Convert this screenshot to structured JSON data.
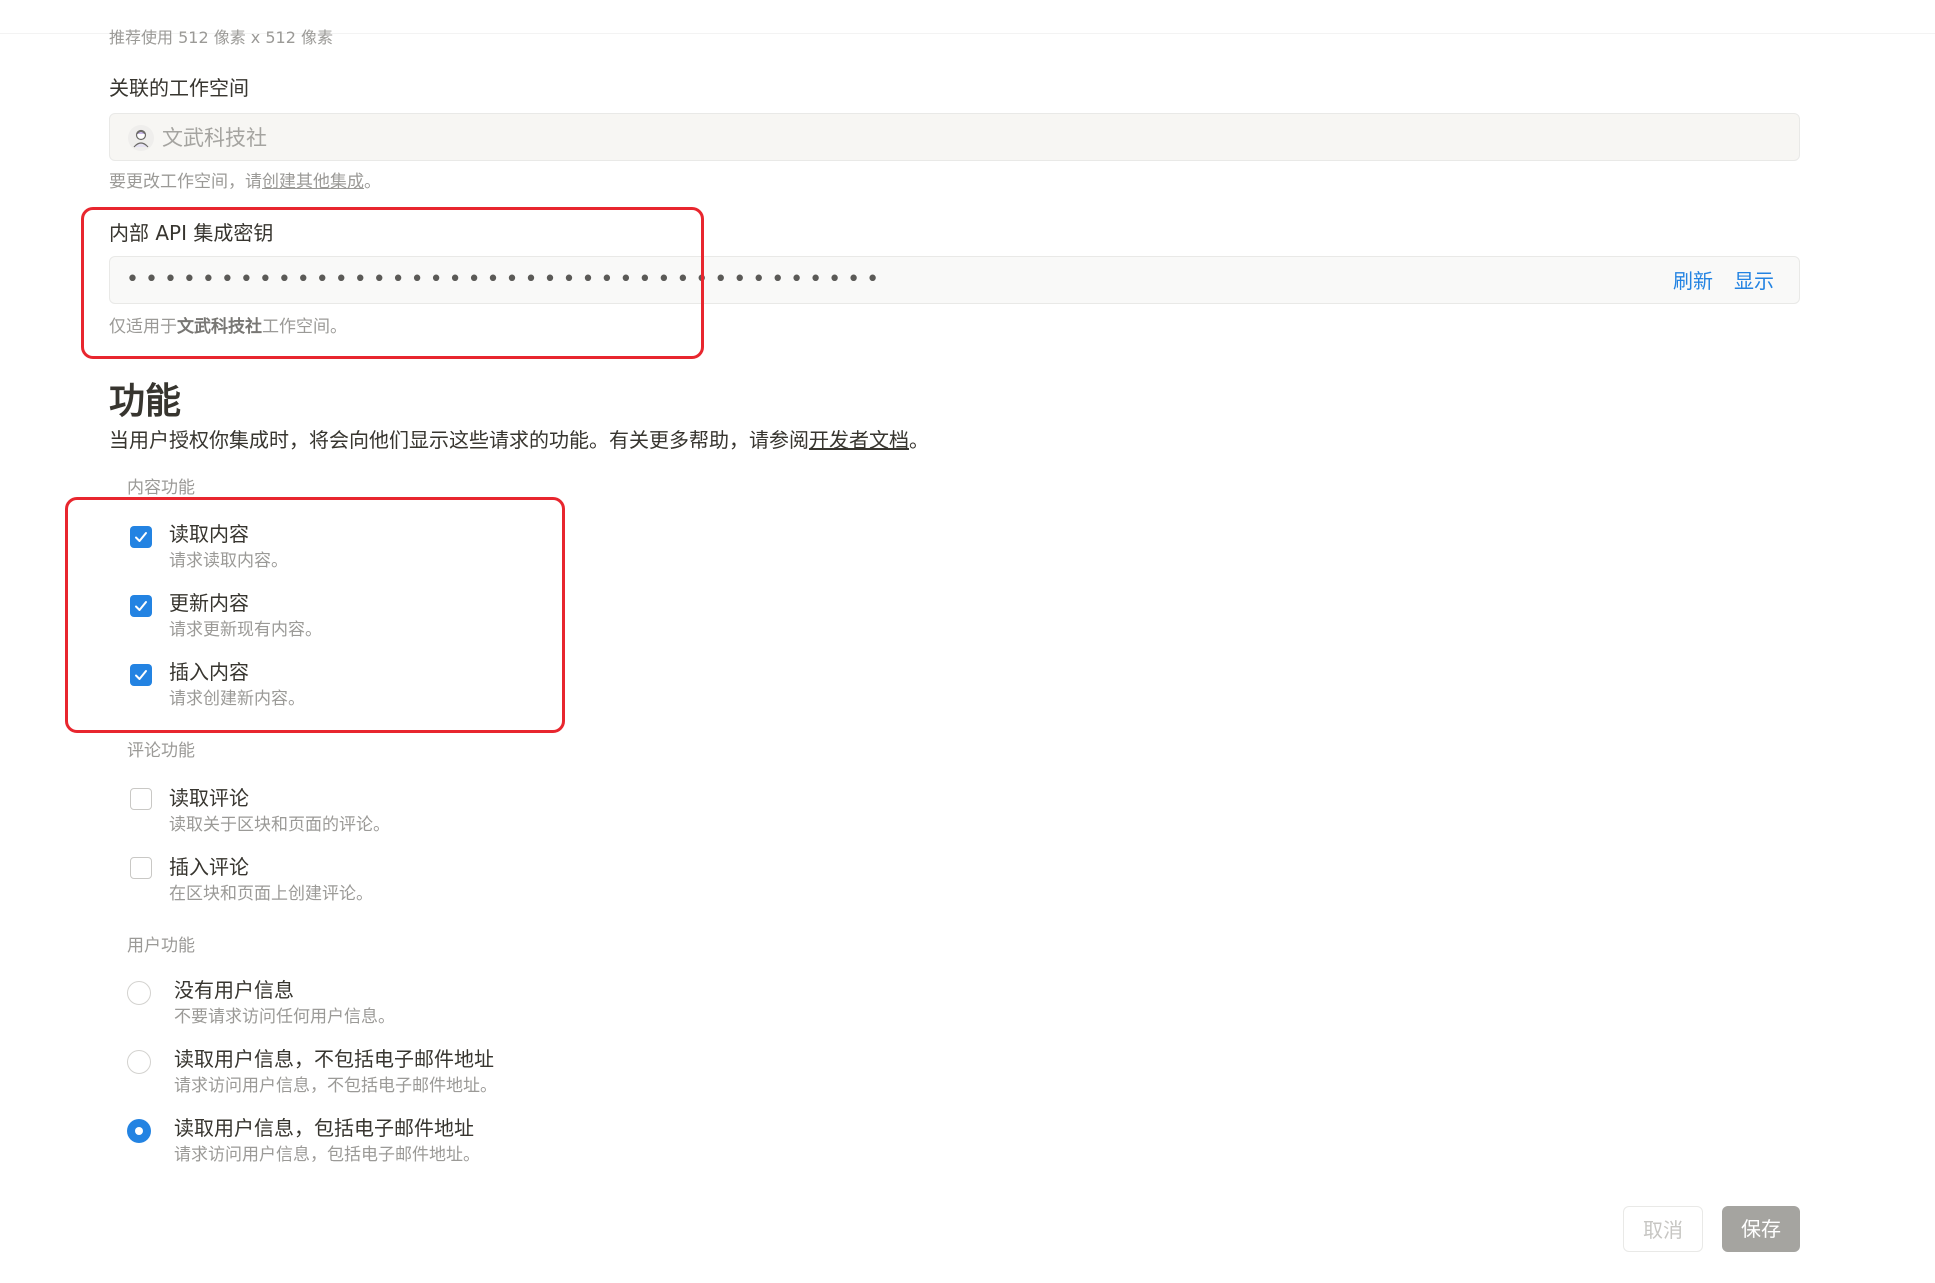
{
  "top_hint": "推荐使用 512 像素 x 512 像素",
  "workspace": {
    "label": "关联的工作空间",
    "name": "文武科技社",
    "help_prefix": "要更改工作空间，请",
    "help_link": "创建其他集成",
    "help_suffix": "。"
  },
  "secret": {
    "label": "内部 API 集成密钥",
    "masked_value": "••••••••••••••••••••••••••••••••••••••••",
    "refresh_label": "刷新",
    "show_label": "显示",
    "help_prefix": "仅适用于",
    "help_workspace": "文武科技社",
    "help_suffix": "工作空间。"
  },
  "capabilities": {
    "title": "功能",
    "desc_prefix": "当用户授权你集成时，将会向他们显示这些请求的功能。有关更多帮助，请参阅",
    "desc_link": "开发者文档",
    "desc_suffix": "。",
    "content": {
      "label": "内容功能",
      "items": [
        {
          "title": "读取内容",
          "desc": "请求读取内容。",
          "checked": true
        },
        {
          "title": "更新内容",
          "desc": "请求更新现有内容。",
          "checked": true
        },
        {
          "title": "插入内容",
          "desc": "请求创建新内容。",
          "checked": true
        }
      ]
    },
    "comments": {
      "label": "评论功能",
      "items": [
        {
          "title": "读取评论",
          "desc": "读取关于区块和页面的评论。",
          "checked": false
        },
        {
          "title": "插入评论",
          "desc": "在区块和页面上创建评论。",
          "checked": false
        }
      ]
    },
    "user": {
      "label": "用户功能",
      "items": [
        {
          "title": "没有用户信息",
          "desc": "不要请求访问任何用户信息。",
          "selected": false
        },
        {
          "title": "读取用户信息，不包括电子邮件地址",
          "desc": "请求访问用户信息，不包括电子邮件地址。",
          "selected": false
        },
        {
          "title": "读取用户信息，包括电子邮件地址",
          "desc": "请求访问用户信息，包括电子邮件地址。",
          "selected": true
        }
      ]
    }
  },
  "actions": {
    "cancel_label": "取消",
    "save_label": "保存"
  },
  "colors": {
    "accent": "#2383e2",
    "annotation": "#e8262e"
  },
  "icons": {
    "workspace": "workspace-avatar-icon",
    "check": "check-icon"
  }
}
